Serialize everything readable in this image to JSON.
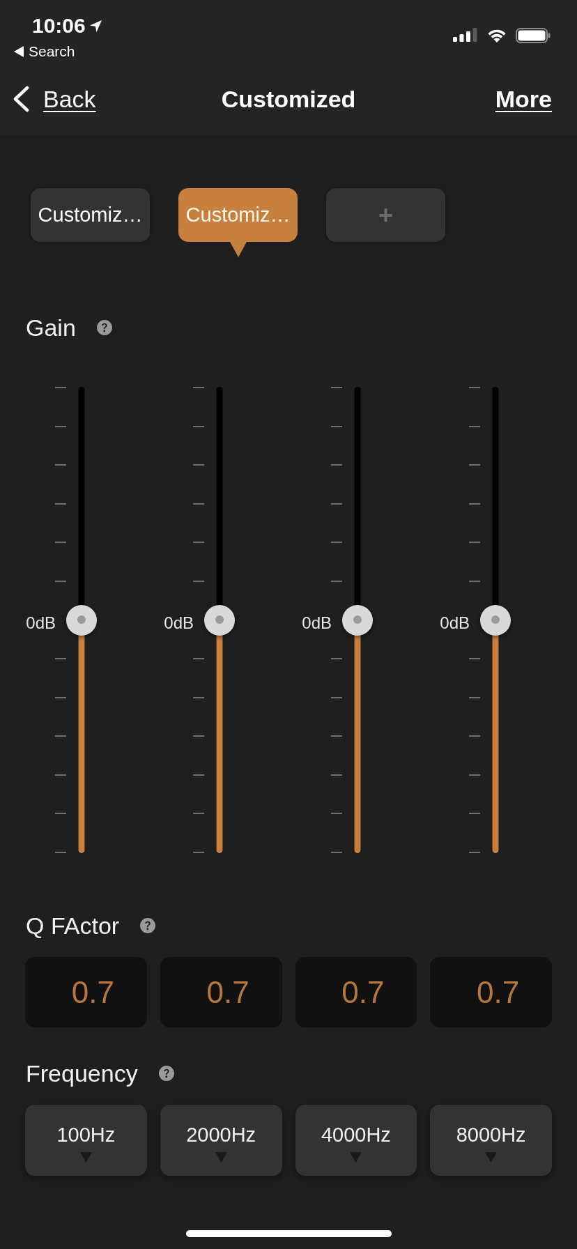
{
  "status_bar": {
    "time": "10:06",
    "back_app": "Search"
  },
  "nav_bar": {
    "back": "Back",
    "title": "Customized",
    "more": "More"
  },
  "presets": [
    {
      "label": "Customiz…",
      "selected": false
    },
    {
      "label": "Customiz…",
      "selected": true
    }
  ],
  "add_preset": {
    "label": "+"
  },
  "gain": {
    "label": "Gain",
    "bands": [
      {
        "reading": "0dB",
        "level": 0.5
      },
      {
        "reading": "0dB",
        "level": 0.5
      },
      {
        "reading": "0dB",
        "level": 0.5
      },
      {
        "reading": "0dB",
        "level": 0.5
      }
    ]
  },
  "q_factor": {
    "label": "Q FActor",
    "values": [
      "0.7",
      "0.7",
      "0.7",
      "0.7"
    ]
  },
  "frequency": {
    "label": "Frequency",
    "values": [
      "100Hz",
      "2000Hz",
      "4000Hz",
      "8000Hz"
    ]
  }
}
